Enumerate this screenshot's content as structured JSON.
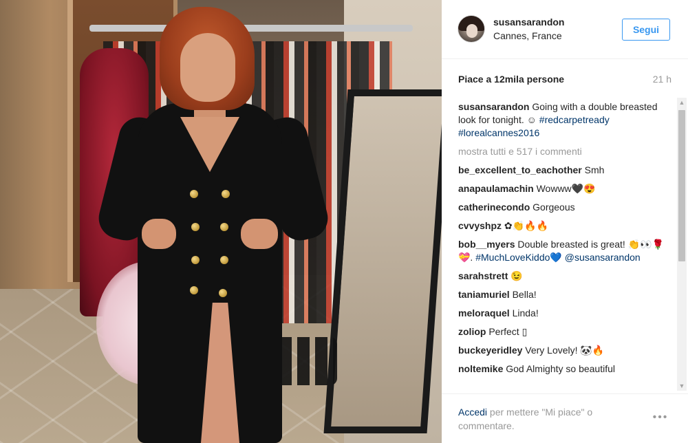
{
  "post": {
    "username": "susansarandon",
    "location": "Cannes, France",
    "follow_label": "Segui",
    "likes": "Piace a 12mila persone",
    "time_ago": "21 h",
    "caption": {
      "user": "susansarandon",
      "text": " Going with a double breasted look for tonight. ☺ ",
      "tags": "#redcarpetready #lorealcannes2016"
    },
    "load_more": "mostra tutti e 517 i commenti",
    "comments": [
      {
        "user": "be_excellent_to_eachother",
        "text": " Smh"
      },
      {
        "user": "anapaulamachin",
        "text": " Wowww🖤😍"
      },
      {
        "user": "catherinecondo",
        "text": " Gorgeous"
      },
      {
        "user": "cvvyshpz",
        "text": " ✿👏🔥🔥"
      },
      {
        "user": "bob__myers",
        "text": " Double breasted is great! 👏👀🌹💝. ",
        "tag": "#MuchLoveKiddo💙 @susansarandon"
      },
      {
        "user": "sarahstrett",
        "text": " 😉"
      },
      {
        "user": "taniamuriel",
        "text": " Bella!"
      },
      {
        "user": "meloraquel",
        "text": " Linda!"
      },
      {
        "user": "zoliop",
        "text": " Perfect ▯"
      },
      {
        "user": "buckeyeridley",
        "text": " Very Lovely! 🐼🔥"
      },
      {
        "user": "noltemike",
        "text": " God Almighty so beautiful"
      }
    ],
    "footer": {
      "login_link": "Accedi",
      "login_text": " per mettere \"Mi piace\" o commentare.",
      "more_label": "•••"
    },
    "scroll": {
      "up": "▲",
      "down": "▼"
    }
  }
}
